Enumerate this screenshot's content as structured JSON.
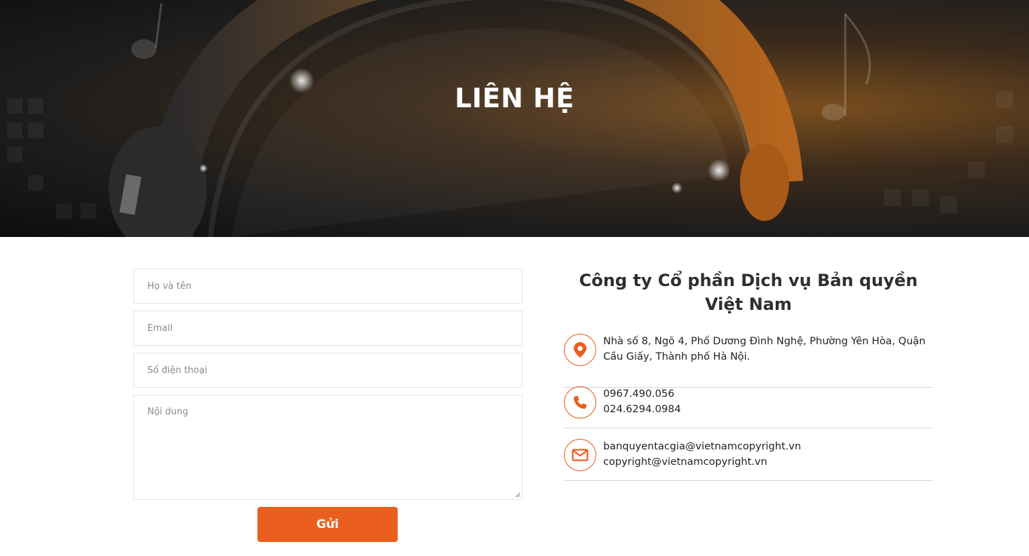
{
  "hero": {
    "title": "LIÊN HỆ"
  },
  "form": {
    "name_placeholder": "Họ và tên",
    "email_placeholder": "Email",
    "phone_placeholder": "Số điện thoại",
    "message_placeholder": "Nội dung",
    "submit_label": "Gửi"
  },
  "contact": {
    "company": "Công ty Cổ phần Dịch vụ Bản quyền Việt Nam",
    "address": "Nhà số 8, Ngõ 4, Phố Dương Đình Nghệ, Phường Yên Hòa, Quận Cầu Giấy, Thành phố Hà Nội.",
    "phone_1": "0967.490.056",
    "phone_2": "024.6294.0984",
    "email_1": "banquyentacgia@vietnamcopyright.vn",
    "email_2": "copyright@vietnamcopyright.vn"
  },
  "icons": {
    "address": "map-pin-icon",
    "phone": "phone-icon",
    "email": "envelope-icon"
  },
  "colors": {
    "accent": "#ea5e1e",
    "text": "#222222",
    "border": "#e4e4e4"
  }
}
